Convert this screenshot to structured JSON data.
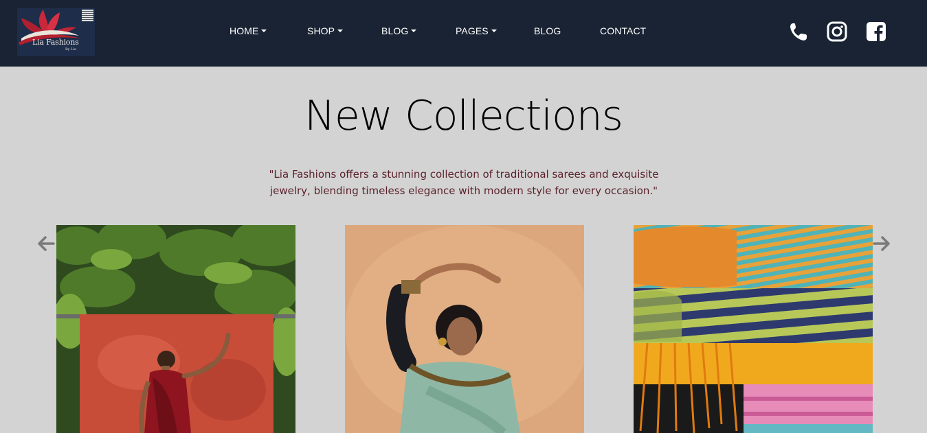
{
  "brand": {
    "logo_text": "Lia Fashions",
    "logo_subtext": "By Lia"
  },
  "nav": {
    "items": [
      {
        "label": "HOME",
        "has_dropdown": true
      },
      {
        "label": "SHOP",
        "has_dropdown": true
      },
      {
        "label": "BLOG",
        "has_dropdown": true
      },
      {
        "label": "PAGES",
        "has_dropdown": true
      },
      {
        "label": "BLOG",
        "has_dropdown": false
      },
      {
        "label": "CONTACT",
        "has_dropdown": false
      }
    ]
  },
  "social": {
    "icons": [
      "phone-icon",
      "instagram-icon",
      "facebook-icon"
    ]
  },
  "hero": {
    "title": "New Collections",
    "subtitle": "\"Lia Fashions offers a stunning collection of traditional sarees and exquisite jewelry, blending timeless elegance with modern style for every occasion.\""
  },
  "carousel": {
    "prev_icon": "arrow-left-icon",
    "next_icon": "arrow-right-icon",
    "items": [
      {
        "image": "woman-in-red-saree-dancing-photo"
      },
      {
        "image": "woman-in-mint-saree-dancing-photo"
      },
      {
        "image": "folded-striped-fabrics-photo"
      }
    ]
  },
  "colors": {
    "header_bg": "#1a2333",
    "page_bg": "#d3d3d3",
    "subtitle_text": "#5a1f2a",
    "nav_text": "#ffffff"
  }
}
